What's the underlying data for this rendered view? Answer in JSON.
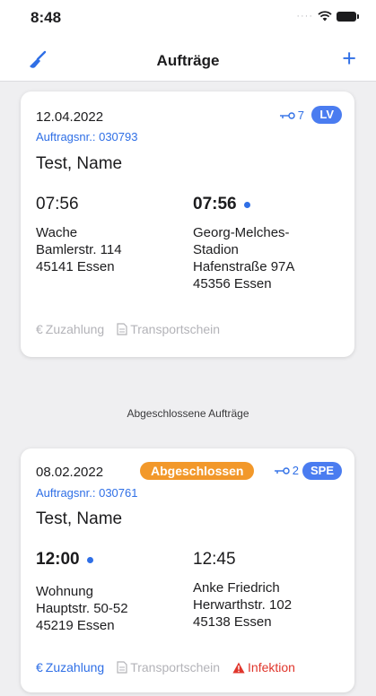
{
  "status_bar": {
    "time": "8:48"
  },
  "nav": {
    "title": "Aufträge",
    "add_label": "+",
    "left_icon": "broom-icon"
  },
  "orders": [
    {
      "date": "12.04.2022",
      "auftrag": "Auftragsnr.: 030793",
      "name": "Test, Name",
      "key_count": "7",
      "type": "LV",
      "status": "",
      "from": {
        "time": "07:56",
        "lines": [
          "Wache",
          "Bamlerstr. 114",
          "45141 Essen"
        ]
      },
      "to": {
        "time": "07:56",
        "lines": [
          "Georg-Melches-",
          "Stadion",
          "Hafenstraße 97A",
          "45356 Essen"
        ]
      },
      "footer": {
        "zuzahlung": "Zuzahlung",
        "transportschein": "Transportschein",
        "infektion": ""
      }
    },
    {
      "date": "08.02.2022",
      "auftrag": "Auftragsnr.: 030761",
      "name": "Test, Name",
      "key_count": "2",
      "type": "SPE",
      "status": "Abgeschlossen",
      "from": {
        "time": "12:00",
        "lines": [
          "Wohnung",
          "Hauptstr. 50-52",
          "45219 Essen"
        ]
      },
      "to": {
        "time": "12:45",
        "lines": [
          "Anke Friedrich",
          "Herwarthstr. 102",
          "45138 Essen"
        ]
      },
      "footer": {
        "zuzahlung": "Zuzahlung",
        "transportschein": "Transportschein",
        "infektion": "Infektion"
      }
    }
  ],
  "section_completed": "Abgeschlossene Aufträge",
  "colors": {
    "accent": "#2f6fe6",
    "status_done": "#f2982a",
    "alert": "#e0362c"
  }
}
